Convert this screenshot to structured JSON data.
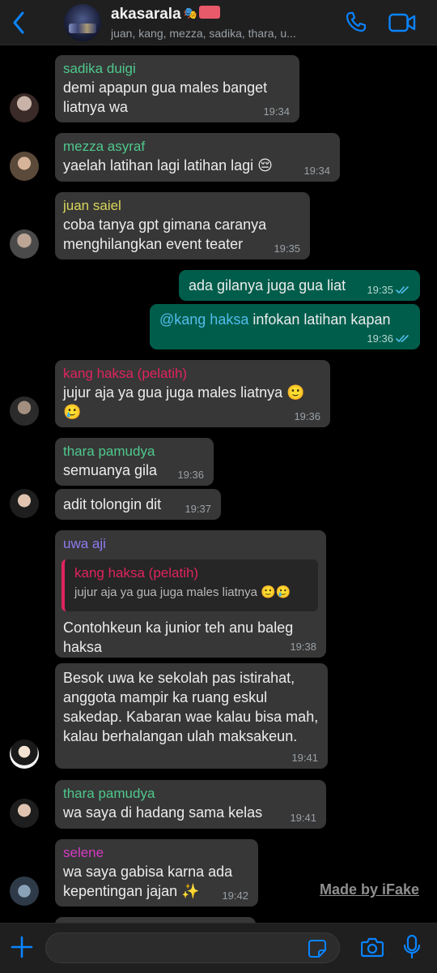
{
  "colors": {
    "accent": "#0a84ff",
    "bubble_in": "#373737",
    "bubble_out": "#005d4b",
    "background": "#000000"
  },
  "header": {
    "title": "akasarala",
    "title_emojis": "🎭",
    "subtitle": "juan, kang, mezza, sadika, thara, u...",
    "icons": [
      "back-chevron-icon",
      "phone-icon",
      "video-camera-icon"
    ]
  },
  "messages": [
    {
      "type": "in",
      "sender": "sadika duigi",
      "sender_color": "#4fc88c",
      "text": "demi apapun gua males banget liatnya wa",
      "time": "19:34"
    },
    {
      "type": "in",
      "sender": "mezza asyraf",
      "sender_color": "#4fc88c",
      "text": "yaelah latihan lagi latihan lagi 😔",
      "time": "19:34"
    },
    {
      "type": "in",
      "sender": "juan saiel",
      "sender_color": "#d9d65a",
      "text": "coba tanya gpt gimana caranya menghilangkan event teater",
      "time": "19:35"
    },
    {
      "type": "out",
      "text": "ada gilanya juga gua liat",
      "time": "19:35"
    },
    {
      "type": "out",
      "mention": "@kang haksa",
      "text": " infokan latihan kapan",
      "time": "19:36"
    },
    {
      "type": "in",
      "sender": "kang haksa (pelatih)",
      "sender_color": "#e0245e",
      "text": "jujur aja ya gua juga males liatnya 🙂 🥲",
      "time": "19:36"
    },
    {
      "type": "in",
      "sender": "thara pamudya",
      "sender_color": "#4fc88c",
      "text": "semuanya gila",
      "time": "19:36"
    },
    {
      "type": "in",
      "text": "adit tolongin dit",
      "time": "19:37"
    },
    {
      "type": "in",
      "sender": "uwa aji",
      "sender_color": "#8c7cf0",
      "quote_sender": "kang haksa (pelatih)",
      "quote_text": "jujur aja ya gua juga males liatnya 🙂🥲",
      "text": "Contohkeun ka junior teh anu baleg haksa",
      "time": "19:38"
    },
    {
      "type": "in",
      "text": "Besok uwa ke sekolah pas istirahat, anggota mampir ka ruang eskul sakedap. Kabaran wae kalau bisa mah, kalau berhalangan ulah maksakeun.",
      "time": "19:41"
    },
    {
      "type": "in",
      "sender": "thara pamudya",
      "sender_color": "#4fc88c",
      "text": "wa saya di hadang sama kelas",
      "time": "19:41"
    },
    {
      "type": "in",
      "sender": "selene",
      "sender_color": "#d63bc4",
      "text": "wa saya gabisa karna ada kepentingan jajan ✨",
      "time": "19:42"
    }
  ],
  "watermark": "Made by iFake",
  "composer": {
    "icons": [
      "plus-icon",
      "sticker-icon",
      "camera-icon",
      "microphone-icon"
    ]
  }
}
